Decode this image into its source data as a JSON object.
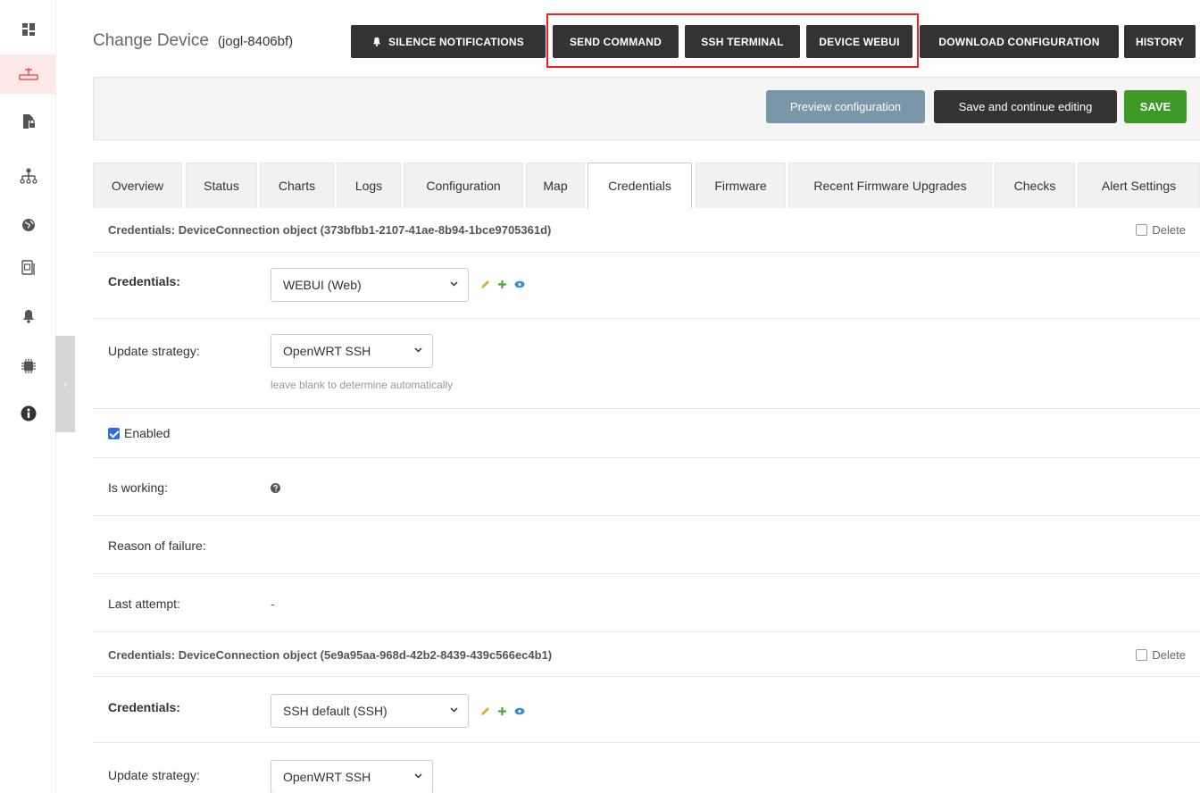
{
  "sidebar": {
    "items": [
      {
        "icon": "dashboard-icon"
      },
      {
        "icon": "router-icon",
        "active": true
      },
      {
        "icon": "file-lock-icon"
      },
      {
        "icon": "network-topology-icon"
      },
      {
        "icon": "globe-icon"
      },
      {
        "icon": "sim-card-icon"
      },
      {
        "icon": "bell-icon"
      },
      {
        "icon": "chip-icon"
      },
      {
        "icon": "info-icon"
      }
    ],
    "toggle": "›"
  },
  "header": {
    "title": "Change Device",
    "device": "(jogl-8406bf)",
    "buttons": {
      "silence": "SILENCE NOTIFICATIONS",
      "send_command": "SEND COMMAND",
      "ssh_terminal": "SSH TERMINAL",
      "device_webui": "DEVICE WEBUI",
      "download_config": "DOWNLOAD CONFIGURATION",
      "history": "HISTORY"
    }
  },
  "submit_row": {
    "preview": "Preview configuration",
    "save_continue": "Save and continue editing",
    "save": "SAVE"
  },
  "tabs": [
    "Overview",
    "Status",
    "Charts",
    "Logs",
    "Configuration",
    "Map",
    "Credentials",
    "Firmware",
    "Recent Firmware Upgrades",
    "Checks",
    "Alert Settings"
  ],
  "active_tab": "Credentials",
  "connection1": {
    "header": "Credentials: DeviceConnection object (373bfbb1-2107-41ae-8b94-1bce9705361d)",
    "delete_label": "Delete",
    "credentials_label": "Credentials:",
    "credentials_value": "WEBUI (Web)",
    "update_strategy_label": "Update strategy:",
    "update_strategy_value": "OpenWRT SSH",
    "update_strategy_help": "leave blank to determine automatically",
    "enabled_label": "Enabled",
    "is_working_label": "Is working:",
    "reason_label": "Reason of failure:",
    "last_attempt_label": "Last attempt:",
    "last_attempt_value": "-"
  },
  "connection2": {
    "header": "Credentials: DeviceConnection object (5e9a95aa-968d-42b2-8439-439c566ec4b1)",
    "delete_label": "Delete",
    "credentials_label": "Credentials:",
    "credentials_value": "SSH default (SSH)",
    "update_strategy_label": "Update strategy:",
    "update_strategy_value": "OpenWRT SSH"
  },
  "colors": {
    "highlight": "#ee2222",
    "save": "#3e9a27",
    "preview": "#7a96a9",
    "dark_button": "#333333",
    "active_sidebar": "#fde7e7",
    "sidebar_accent": "#e85a5a"
  }
}
